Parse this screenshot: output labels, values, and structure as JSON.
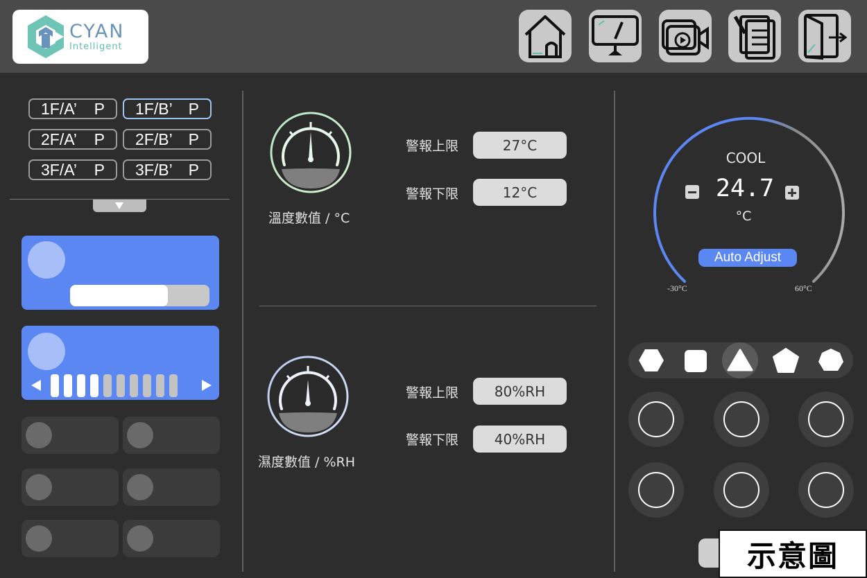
{
  "brand": {
    "name": "CYAN",
    "sub": "Intelligent"
  },
  "nav": {
    "icons": [
      "home-icon",
      "monitor-icon",
      "video-camera-icon",
      "notes-icon",
      "logout-icon"
    ]
  },
  "floors": [
    {
      "floor": "1F/A’",
      "suffix": "P",
      "active": false
    },
    {
      "floor": "1F/B’",
      "suffix": "P",
      "active": true
    },
    {
      "floor": "2F/A’",
      "suffix": "P",
      "active": false
    },
    {
      "floor": "2F/B’",
      "suffix": "P",
      "active": false
    },
    {
      "floor": "3F/A’",
      "suffix": "P",
      "active": false
    },
    {
      "floor": "3F/B’",
      "suffix": "P",
      "active": false
    }
  ],
  "controls": {
    "slider_fill_fraction": 0.7,
    "level_segments": 10,
    "level_active": 4
  },
  "temperature": {
    "gauge_label": "溫度數值 / °C",
    "upper_label": "警報上限",
    "upper_value": "27°C",
    "lower_label": "警報下限",
    "lower_value": "12°C"
  },
  "humidity": {
    "gauge_label": "濕度數值 / %RH",
    "upper_label": "警報上限",
    "upper_value": "80%RH",
    "lower_label": "警報下限",
    "lower_value": "40%RH"
  },
  "thermostat": {
    "mode": "COOL",
    "setpoint": "24.7",
    "unit": "°C",
    "auto_label": "Auto Adjust",
    "min_label": "-30°C",
    "max_label": "60°C",
    "arc_color": "#5b87f3"
  },
  "shapes": [
    "hexagon-icon",
    "square-icon",
    "triangle-icon",
    "pentagon-icon",
    "heptagon-icon"
  ],
  "watermark": "示意圖"
}
